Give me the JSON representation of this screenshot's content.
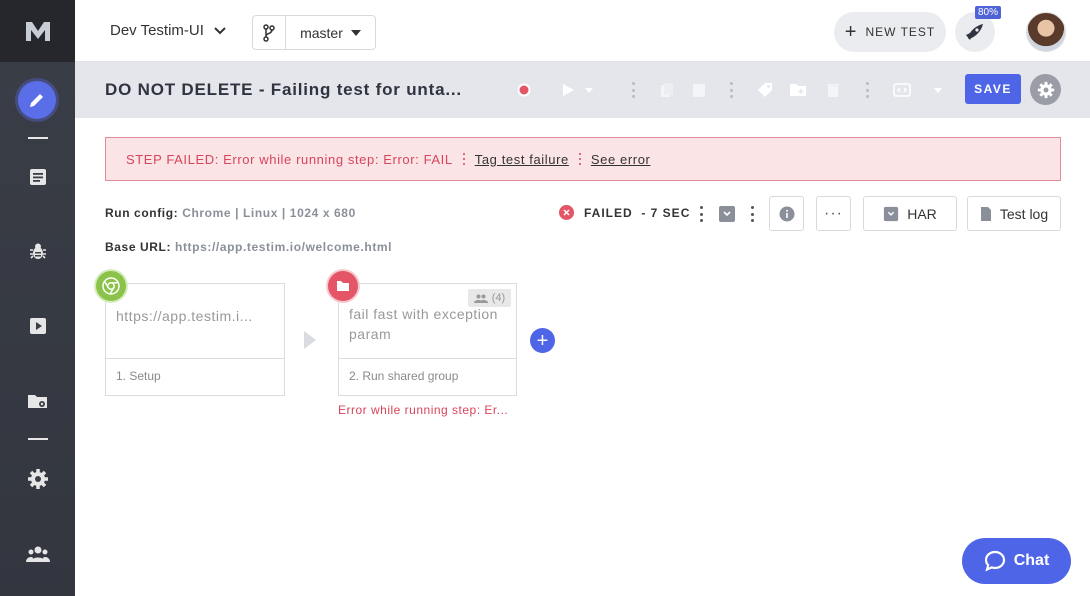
{
  "topbar": {
    "project_name": "Dev Testim-UI",
    "branch": "master",
    "new_test_label": "NEW TEST",
    "notification_badge": "80%"
  },
  "toolbar": {
    "test_title": "DO NOT DELETE - Failing test for unta...",
    "save_label": "SAVE"
  },
  "error_banner": {
    "message": "STEP FAILED: Error while running step: Error: FAIL",
    "tag_link": "Tag test failure",
    "see_error_link": "See error"
  },
  "run_info": {
    "run_config_label": "Run config:",
    "run_config_value": "Chrome | Linux | 1024 x 680",
    "base_url_label": "Base URL:",
    "base_url_value": "https://app.testim.io/welcome.html",
    "status": "FAILED",
    "duration": "- 7 SEC",
    "har_label": "HAR",
    "test_log_label": "Test log"
  },
  "steps": [
    {
      "title": "https://app.testim.i...",
      "footer": "1. Setup"
    },
    {
      "title": "fail fast with exception param",
      "footer": "2. Run shared group",
      "members": "(4)",
      "error": "Error while running step: Er..."
    }
  ],
  "chat_label": "Chat",
  "colors": {
    "accent": "#4f65e8",
    "error": "#d9445a",
    "success": "#8bc34a",
    "sidebar": "#3a3e47"
  }
}
